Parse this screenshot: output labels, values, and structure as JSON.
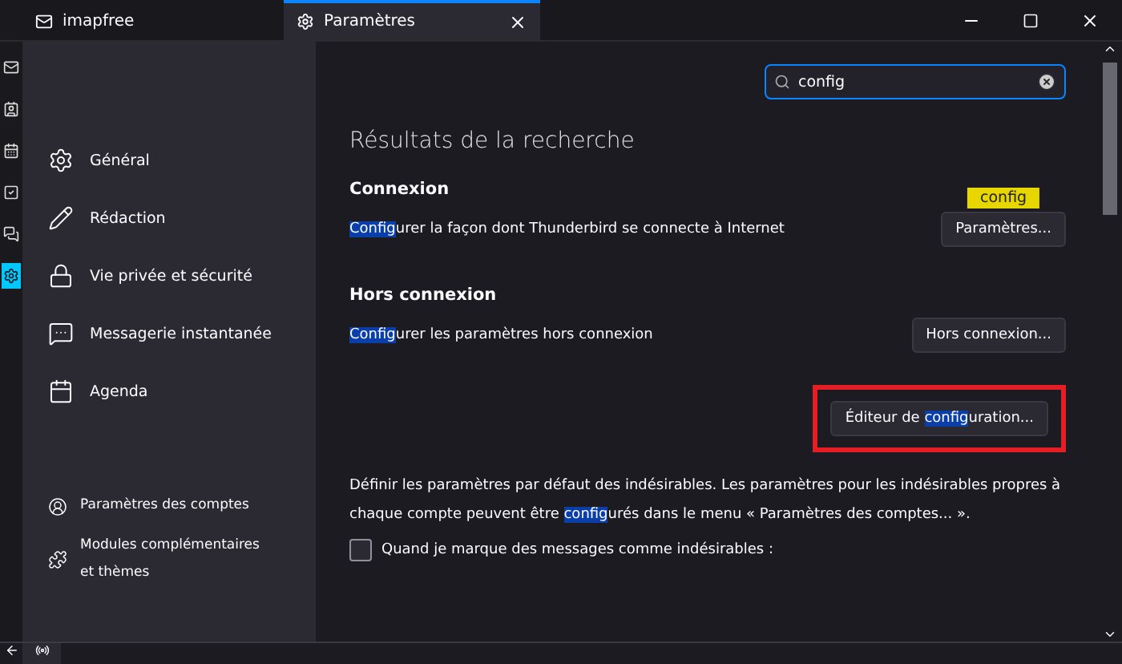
{
  "tabs": [
    {
      "label": "imapfree",
      "selected": false,
      "kind": "mail"
    },
    {
      "label": "Paramètres",
      "selected": true,
      "kind": "settings",
      "closable": true
    }
  ],
  "spaces": [
    {
      "kind": "mail",
      "selected": false
    },
    {
      "kind": "contacts",
      "selected": false
    },
    {
      "kind": "calendar",
      "selected": false
    },
    {
      "kind": "tasks",
      "selected": false
    },
    {
      "kind": "chat",
      "selected": false
    },
    {
      "kind": "settings",
      "selected": true
    }
  ],
  "sidebar": {
    "items": [
      {
        "label": "Général",
        "kind": "gear"
      },
      {
        "label": "Rédaction",
        "kind": "pencil"
      },
      {
        "label": "Vie privée et sécurité",
        "kind": "lock"
      },
      {
        "label": "Messagerie instantanée",
        "kind": "chat"
      },
      {
        "label": "Agenda",
        "kind": "calendar"
      }
    ],
    "footer_items": [
      {
        "label": "Paramètres des comptes",
        "kind": "account"
      },
      {
        "label": "Modules complémentaires et thèmes",
        "kind": "puzzle"
      }
    ]
  },
  "search": {
    "value": "config"
  },
  "heading": "Résultats de la recherche",
  "sections": [
    {
      "title": "Connexion",
      "text": [
        {
          "t": "Config",
          "hl": true
        },
        {
          "t": "urer la façon dont Thunderbird se connecte à Internet",
          "hl": false
        }
      ],
      "button": [
        {
          "t": "Paramètres...",
          "hl": false
        }
      ],
      "tooltip": "config"
    },
    {
      "title": "Hors connexion",
      "text": [
        {
          "t": "Config",
          "hl": true
        },
        {
          "t": "urer les paramètres hors connexion",
          "hl": false
        }
      ],
      "button": [
        {
          "t": "Hors connexion...",
          "hl": false
        }
      ]
    }
  ],
  "editor_button": {
    "parts": [
      {
        "t": "Éditeur de ",
        "hl": false
      },
      {
        "t": "config",
        "hl": true
      },
      {
        "t": "uration...",
        "hl": false
      }
    ],
    "outlined": true
  },
  "junk_text": [
    {
      "t": "Définir les paramètres par défaut des indésirables. Les paramètres pour les indésirables propres à chaque compte peuvent être ",
      "hl": false
    },
    {
      "t": "config",
      "hl": true
    },
    {
      "t": "urés dans le menu « Paramètres des comptes... ».",
      "hl": false
    }
  ],
  "junk_checkbox": {
    "label": "Quand je marque des messages comme indésirables :",
    "checked": false
  }
}
